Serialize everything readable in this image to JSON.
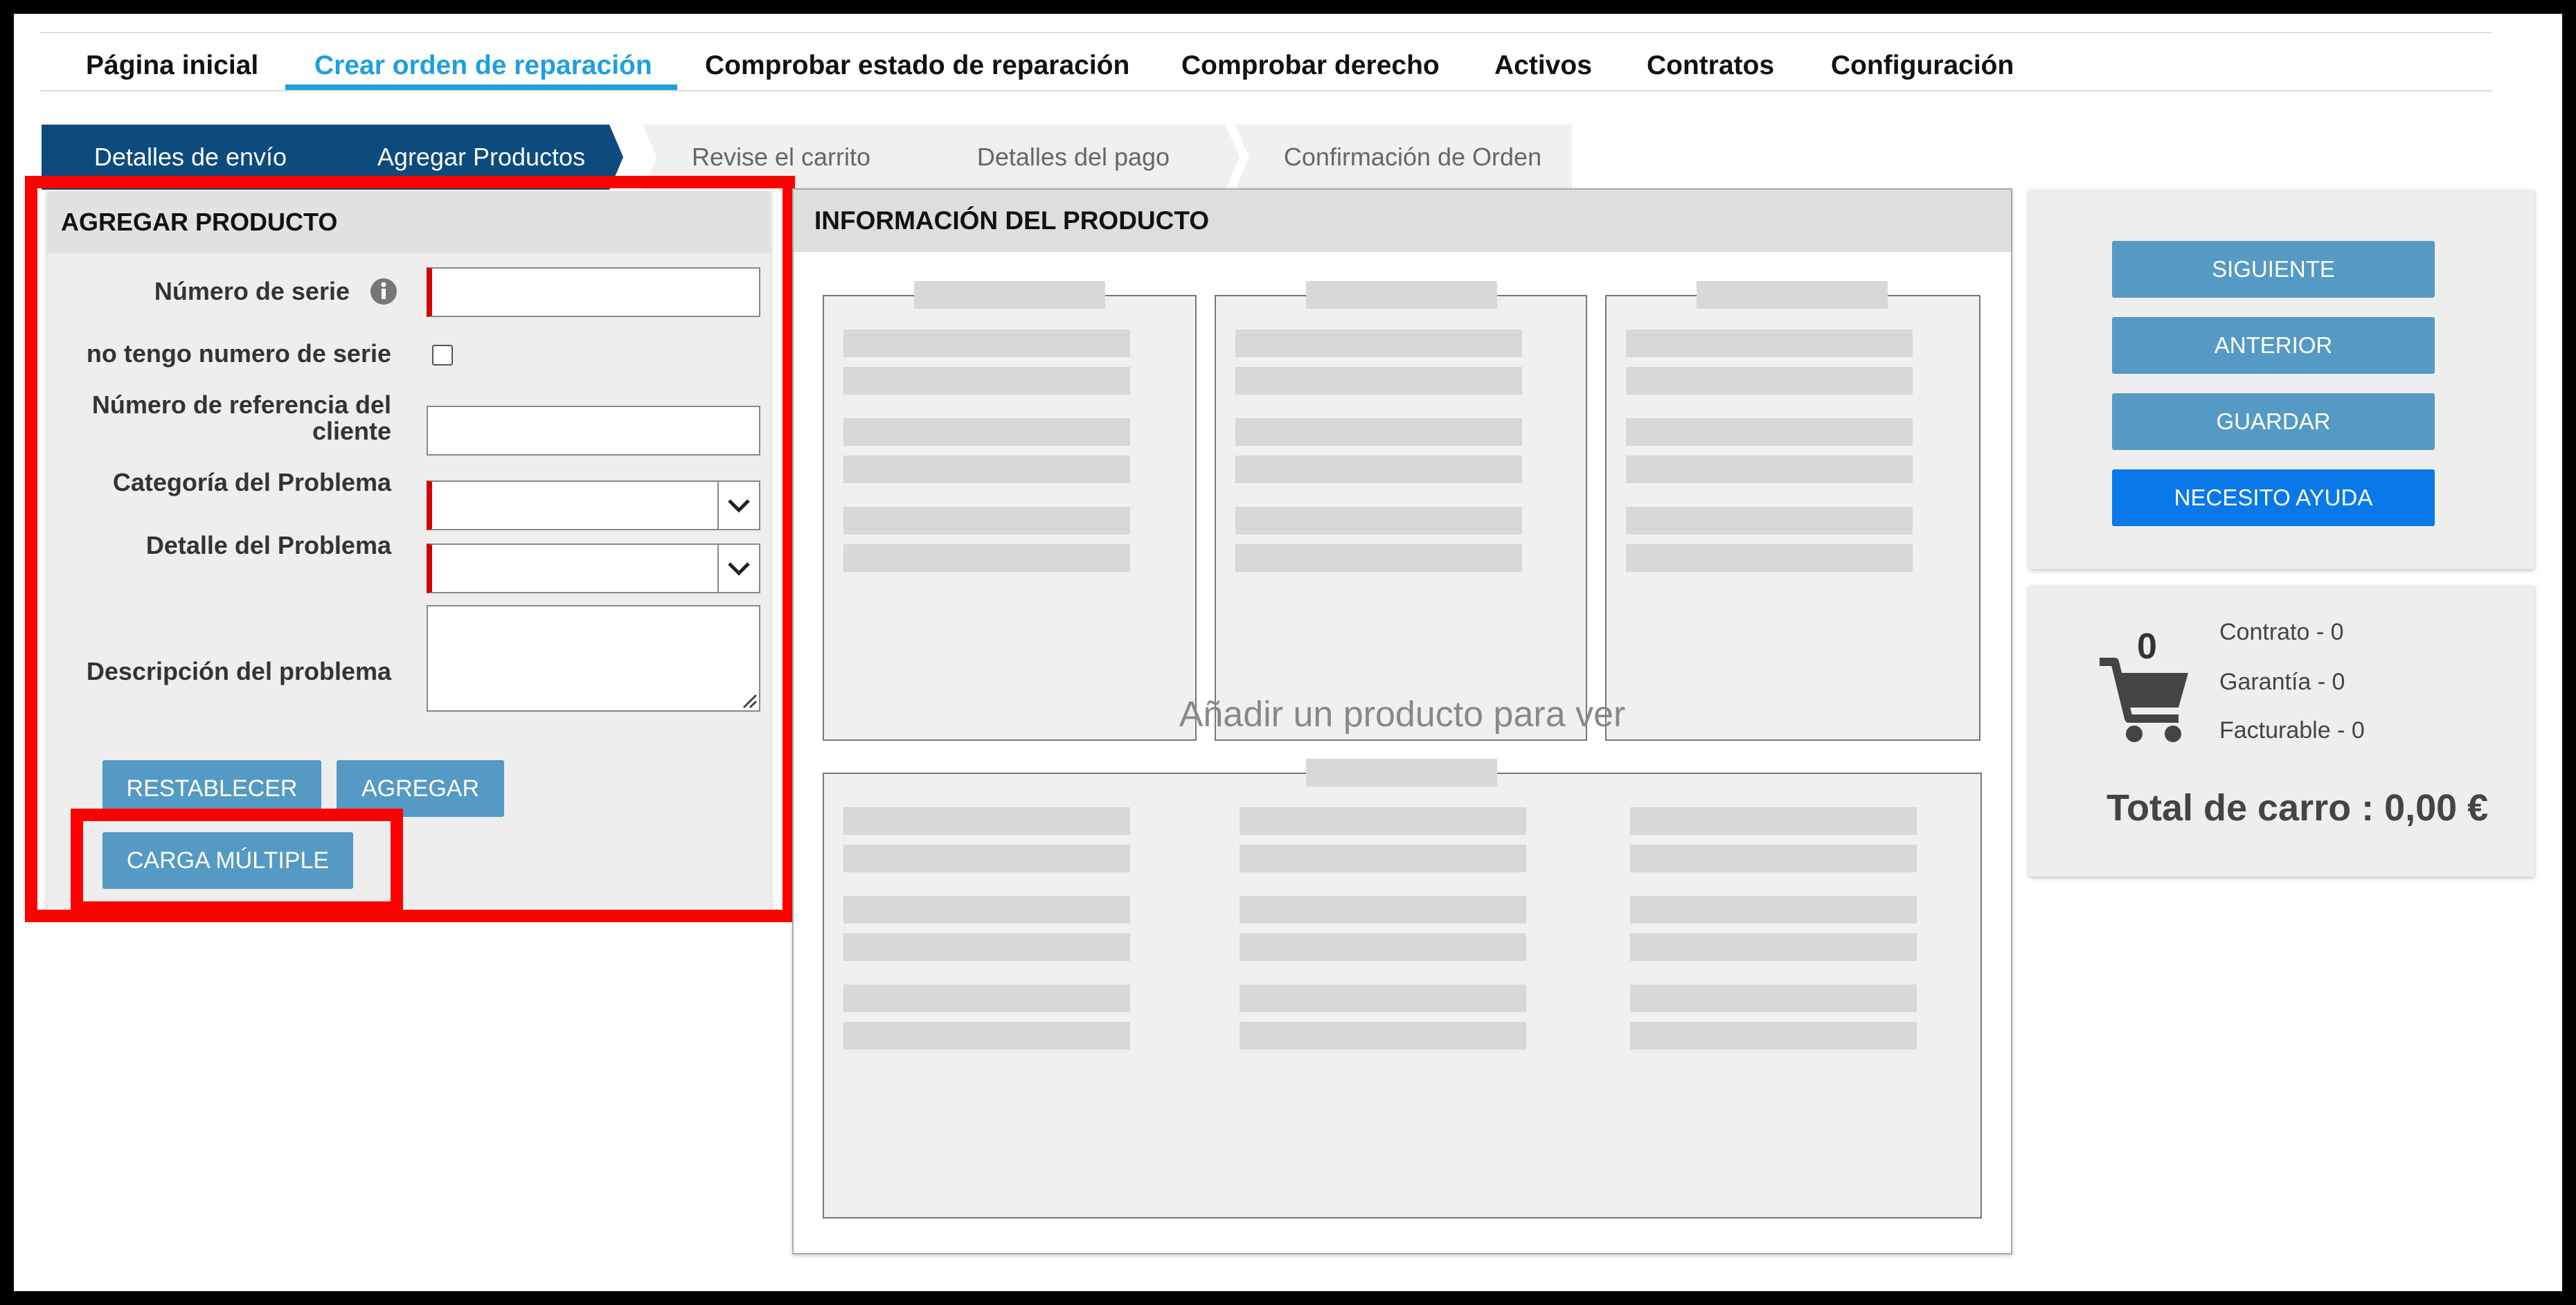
{
  "nav": {
    "items": [
      {
        "label": "Página inicial"
      },
      {
        "label": "Crear orden de reparación"
      },
      {
        "label": "Comprobar estado de reparación"
      },
      {
        "label": "Comprobar derecho"
      },
      {
        "label": "Activos"
      },
      {
        "label": "Contratos"
      },
      {
        "label": "Configuración"
      }
    ],
    "active_index": 1
  },
  "steps": [
    {
      "label": "Detalles de envío",
      "state": "done"
    },
    {
      "label": "Agregar Productos",
      "state": "current"
    },
    {
      "label": "Revise el carrito",
      "state": "todo"
    },
    {
      "label": "Detalles del pago",
      "state": "todo"
    },
    {
      "label": "Confirmación de Orden",
      "state": "todo"
    }
  ],
  "add_product": {
    "title": "AGREGAR PRODUCTO",
    "serial_label": "Número de serie",
    "serial_value": "",
    "no_serial_label": "no tengo numero de serie",
    "no_serial_checked": false,
    "customer_ref_label_line1": "Número de referencia del",
    "customer_ref_label_line2": "cliente",
    "customer_ref_value": "",
    "problem_category_label": "Categoría del Problema",
    "problem_category_value": "",
    "problem_detail_label": "Detalle del Problema",
    "problem_detail_value": "",
    "problem_description_label": "Descripción del problema",
    "problem_description_value": "",
    "reset_button": "RESTABLECER",
    "add_button": "AGREGAR",
    "bulk_button": "CARGA MÚLTIPLE"
  },
  "product_info": {
    "title": "INFORMACIÓN DEL PRODUCTO",
    "placeholder": "Añadir un producto para ver"
  },
  "actions": {
    "next": "SIGUIENTE",
    "previous": "ANTERIOR",
    "save": "GUARDAR",
    "help": "NECESITO AYUDA"
  },
  "cart": {
    "count": "0",
    "contract": "Contrato - 0",
    "warranty": "Garantía - 0",
    "billable": "Facturable - 0",
    "total": "Total de carro : 0,00 €"
  },
  "colors": {
    "accent": "#1ea0dc",
    "step_done": "#0d4a7d",
    "button": "#559ac4",
    "help_button": "#0a78e8",
    "required": "#d40000",
    "highlight": "#ff0000"
  }
}
